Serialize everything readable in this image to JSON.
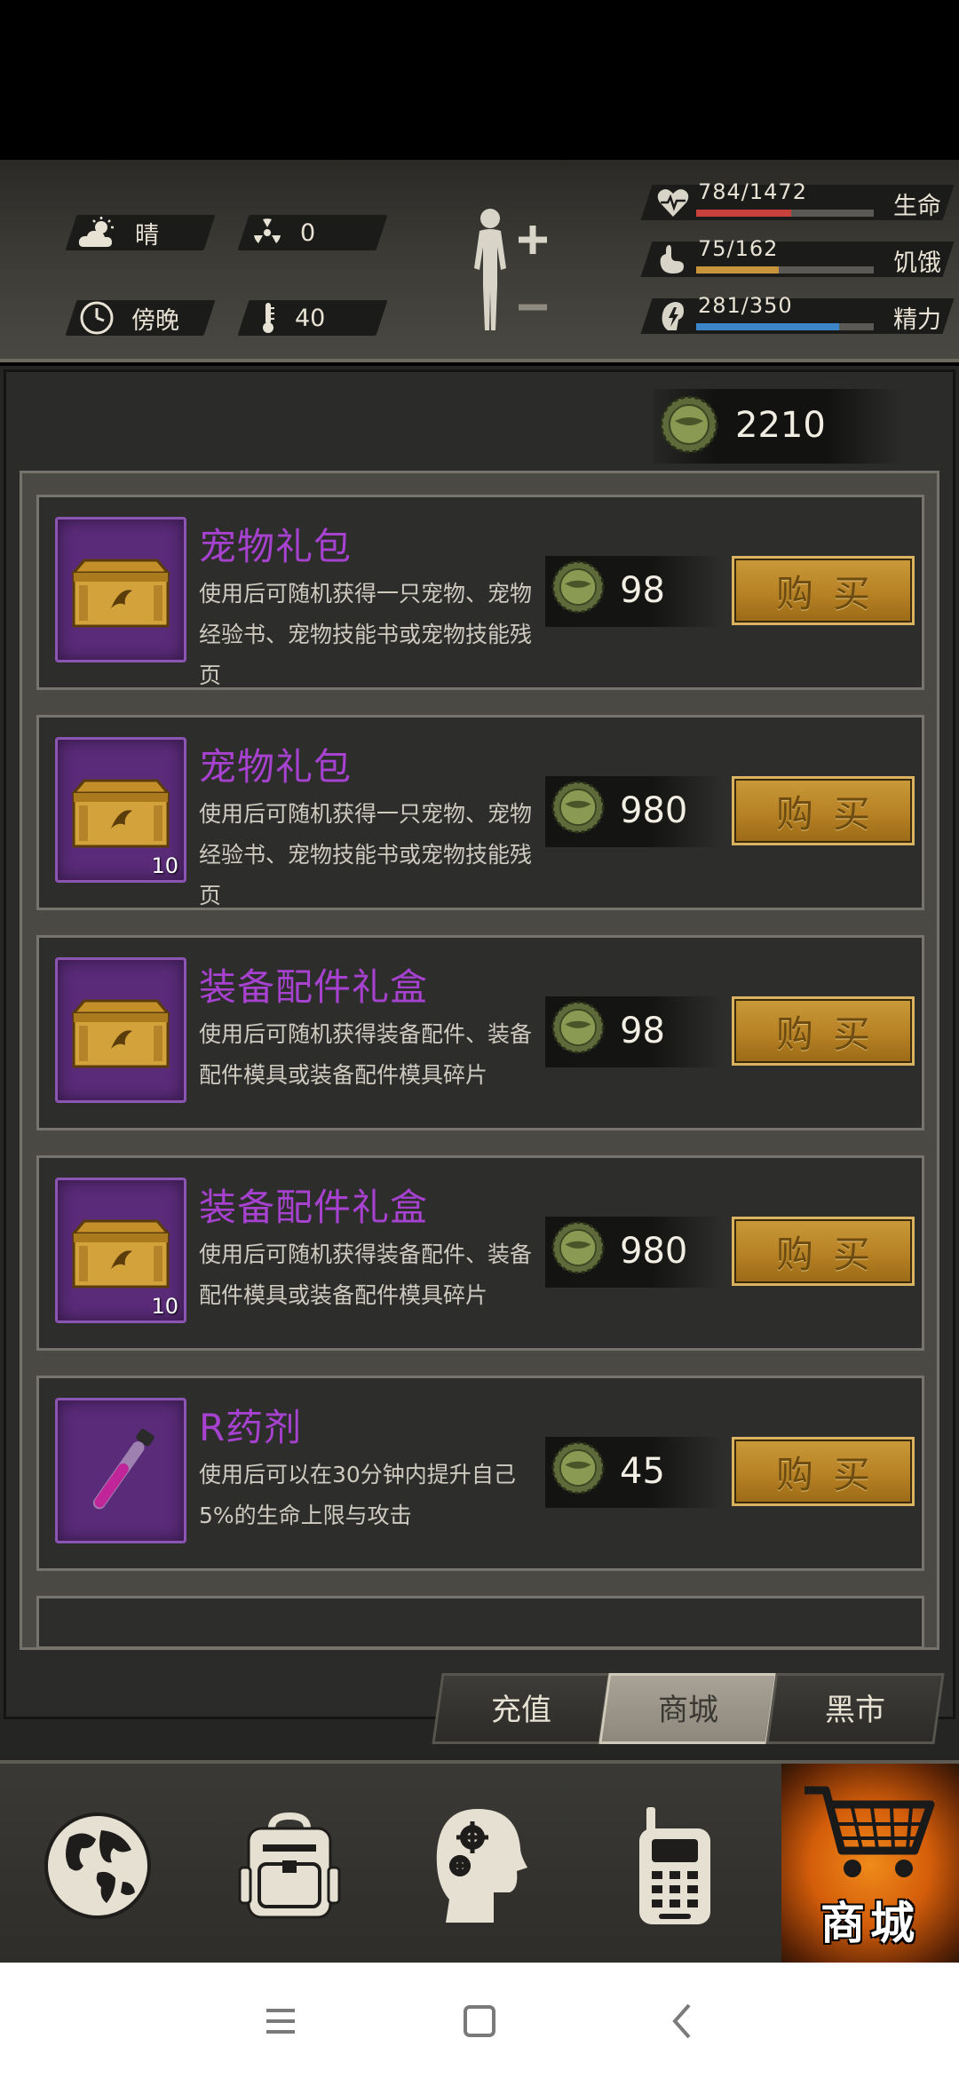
{
  "header": {
    "weather": {
      "icon": "cloud-sun-icon",
      "label": "晴"
    },
    "radiation": {
      "icon": "radiation-icon",
      "value": "0"
    },
    "time": {
      "icon": "clock-icon",
      "label": "傍晚"
    },
    "temperature": {
      "icon": "thermometer-icon",
      "value": "40"
    },
    "stats": [
      {
        "icon": "heart-icon",
        "text": "784/1472",
        "label": "生命",
        "current": 784,
        "max": 1472,
        "color": "#c8403a"
      },
      {
        "icon": "stomach-icon",
        "text": "75/162",
        "label": "饥饿",
        "current": 75,
        "max": 162,
        "color": "#c8943a"
      },
      {
        "icon": "energy-icon",
        "text": "281/350",
        "label": "精力",
        "current": 281,
        "max": 350,
        "color": "#3a86c8"
      }
    ]
  },
  "currency": {
    "icon": "bottle-cap-coin-icon",
    "value": "2210"
  },
  "shop_items": [
    {
      "name": "宠物礼包",
      "desc": "使用后可随机获得一只宠物、宠物经验书、宠物技能书或宠物技能残页",
      "price": "98",
      "count": "",
      "icon": "golden-crate-icon"
    },
    {
      "name": "宠物礼包",
      "desc": "使用后可随机获得一只宠物、宠物经验书、宠物技能书或宠物技能残页",
      "price": "980",
      "count": "10",
      "icon": "golden-crate-icon"
    },
    {
      "name": "装备配件礼盒",
      "desc": "使用后可随机获得装备配件、装备配件模具或装备配件模具碎片",
      "price": "98",
      "count": "",
      "icon": "golden-crate-icon"
    },
    {
      "name": "装备配件礼盒",
      "desc": "使用后可随机获得装备配件、装备配件模具或装备配件模具碎片",
      "price": "980",
      "count": "10",
      "icon": "golden-crate-icon"
    },
    {
      "name": "R药剂",
      "desc": "使用后可以在30分钟内提升自己5%的生命上限与攻击",
      "price": "45",
      "count": "",
      "icon": "potion-vial-icon"
    }
  ],
  "buy_label": "购买",
  "tabs": [
    {
      "label": "充值",
      "active": false
    },
    {
      "label": "商城",
      "active": true
    },
    {
      "label": "黑市",
      "active": false
    }
  ],
  "bottom_nav": [
    {
      "icon": "globe-icon"
    },
    {
      "icon": "backpack-icon"
    },
    {
      "icon": "head-gears-icon"
    },
    {
      "icon": "radio-phone-icon"
    },
    {
      "icon": "shopping-cart-icon",
      "label": "商城"
    }
  ],
  "system_nav": [
    "menu-icon",
    "home-square-icon",
    "back-chevron-icon"
  ],
  "colors": {
    "item_name": "#a642cf",
    "buy_button": "#b78124",
    "shop_tab_highlight": "#e07414"
  }
}
